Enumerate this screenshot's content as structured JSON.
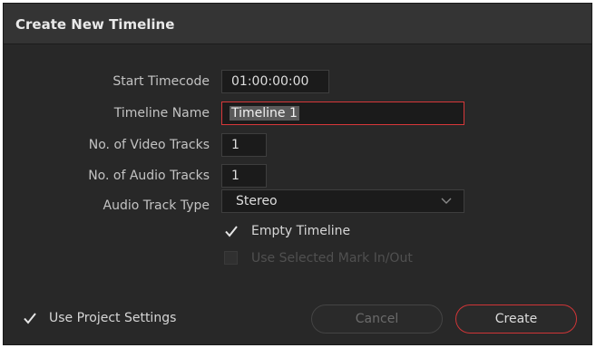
{
  "dialog": {
    "title": "Create New Timeline"
  },
  "form": {
    "start_timecode": {
      "label": "Start Timecode",
      "value": "01:00:00:00"
    },
    "timeline_name": {
      "label": "Timeline Name",
      "value": "Timeline 1"
    },
    "video_tracks": {
      "label": "No. of Video Tracks",
      "value": "1"
    },
    "audio_tracks": {
      "label": "No. of Audio Tracks",
      "value": "1"
    },
    "audio_track_type": {
      "label": "Audio Track Type",
      "value": "Stereo"
    },
    "empty_timeline": {
      "label": "Empty Timeline",
      "checked": true
    },
    "use_mark_in_out": {
      "label": "Use Selected Mark In/Out",
      "checked": false,
      "enabled": false
    }
  },
  "footer": {
    "use_project_settings": {
      "label": "Use Project Settings",
      "checked": true
    },
    "cancel_label": "Cancel",
    "create_label": "Create"
  },
  "colors": {
    "accent": "#d7383a",
    "background": "#282828",
    "titlebar": "#343434"
  }
}
